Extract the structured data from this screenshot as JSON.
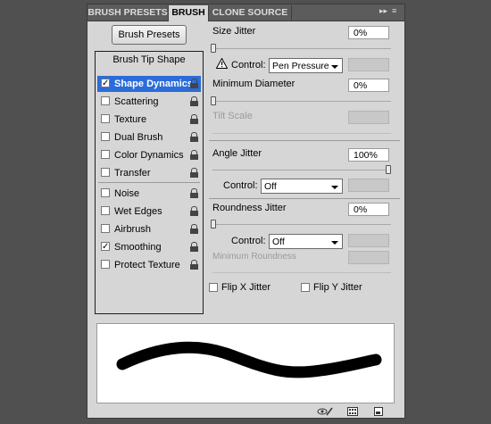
{
  "tabs": [
    {
      "label": "BRUSH PRESETS",
      "active": false
    },
    {
      "label": "BRUSH",
      "active": true
    },
    {
      "label": "CLONE SOURCE",
      "active": false
    }
  ],
  "panel_menu": {
    "collapse_glyph": "▸▸",
    "menu_glyph": "≡"
  },
  "brush_presets_button": "Brush Presets",
  "list": {
    "heading": "Brush Tip Shape",
    "items": [
      {
        "label": "Shape Dynamics",
        "checked": true,
        "selected": true
      },
      {
        "label": "Scattering",
        "checked": false
      },
      {
        "label": "Texture",
        "checked": false
      },
      {
        "label": "Dual Brush",
        "checked": false
      },
      {
        "label": "Color Dynamics",
        "checked": false
      },
      {
        "label": "Transfer",
        "checked": false
      },
      {
        "label": "Noise",
        "checked": false
      },
      {
        "label": "Wet Edges",
        "checked": false
      },
      {
        "label": "Airbrush",
        "checked": false
      },
      {
        "label": "Smoothing",
        "checked": true
      },
      {
        "label": "Protect Texture",
        "checked": false
      }
    ]
  },
  "settings": {
    "size_jitter": {
      "label": "Size Jitter",
      "value": "0%",
      "slider": 0
    },
    "size_control": {
      "label": "Control:",
      "value": "Pen Pressure"
    },
    "min_diameter": {
      "label": "Minimum Diameter",
      "value": "0%",
      "slider": 0
    },
    "tilt_scale": {
      "label": "Tilt Scale"
    },
    "angle_jitter": {
      "label": "Angle Jitter",
      "value": "100%",
      "slider": 1
    },
    "angle_control": {
      "label": "Control:",
      "value": "Off"
    },
    "roundness_jitter": {
      "label": "Roundness Jitter",
      "value": "0%",
      "slider": 0
    },
    "roundness_control": {
      "label": "Control:",
      "value": "Off"
    },
    "min_roundness": {
      "label": "Minimum Roundness"
    },
    "flip_x": {
      "label": "Flip X Jitter",
      "checked": false
    },
    "flip_y": {
      "label": "Flip Y Jitter",
      "checked": false
    }
  },
  "colors": {
    "selection": "#2b6cd9",
    "panel": "#d6d6d6",
    "tab_bar": "#5c5c5c"
  }
}
